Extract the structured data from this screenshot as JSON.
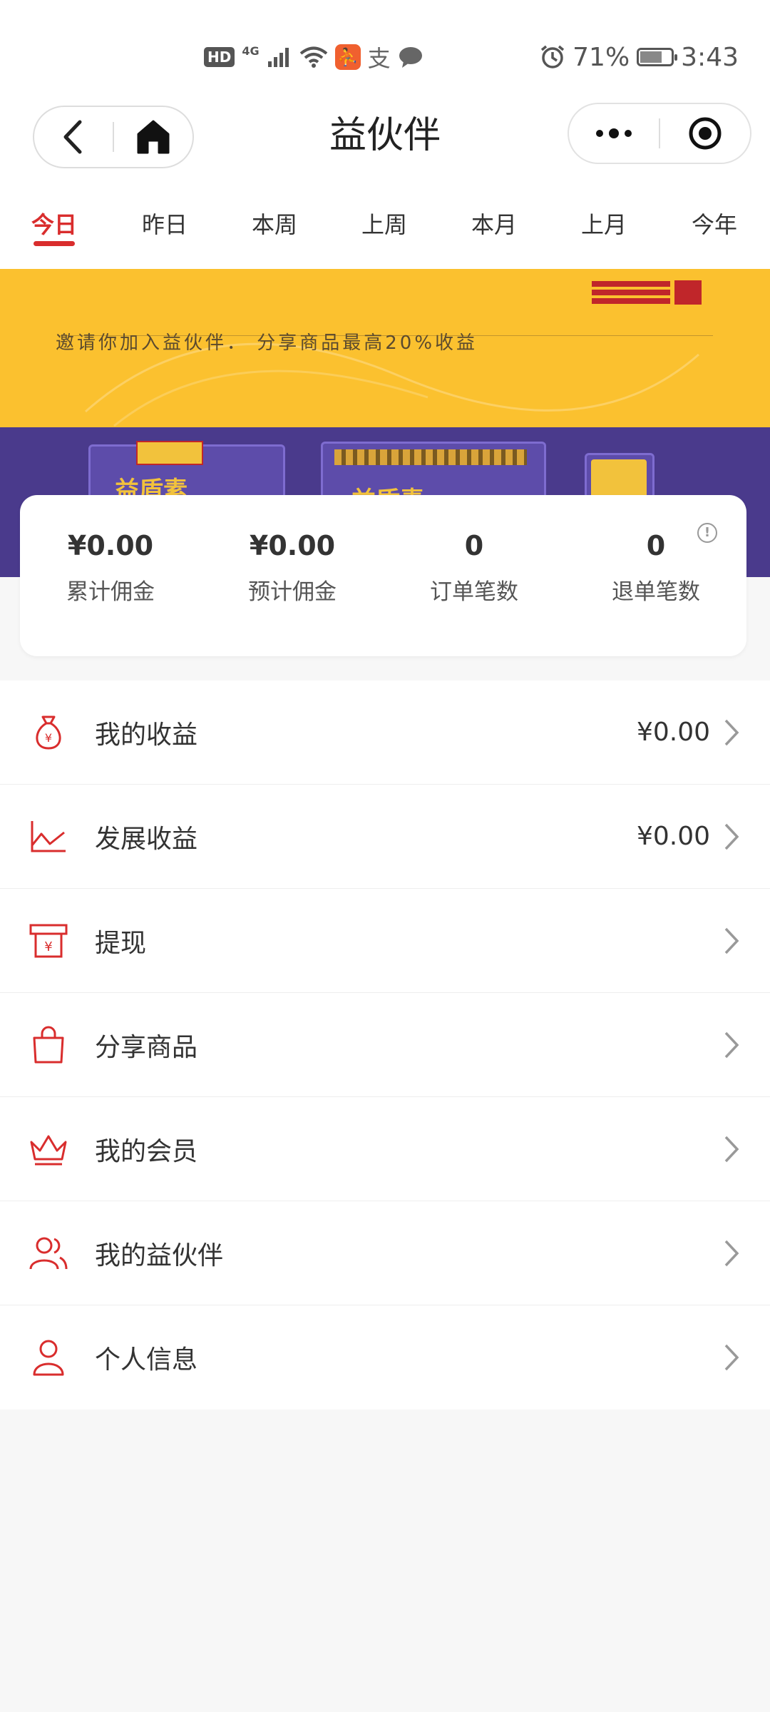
{
  "status_bar": {
    "hd": "HD",
    "network": "4G",
    "app_badge": "支",
    "battery": "71%",
    "battery_level": 0.71,
    "time": "3:43"
  },
  "header": {
    "title": "益伙伴"
  },
  "tabs": [
    {
      "label": "今日",
      "active": true
    },
    {
      "label": "昨日",
      "active": false
    },
    {
      "label": "本周",
      "active": false
    },
    {
      "label": "上周",
      "active": false
    },
    {
      "label": "本月",
      "active": false
    },
    {
      "label": "上月",
      "active": false
    },
    {
      "label": "今年",
      "active": false
    }
  ],
  "banner": {
    "slogan": "邀请你加入益伙伴． 分享商品最高20%收益",
    "product_name": "益盾素",
    "colors": {
      "top": "#fbc12f",
      "bottom": "#4a3a8c"
    }
  },
  "stats": [
    {
      "value": "¥0.00",
      "label": "累计佣金"
    },
    {
      "value": "¥0.00",
      "label": "预计佣金"
    },
    {
      "value": "0",
      "label": "订单笔数"
    },
    {
      "value": "0",
      "label": "退单笔数"
    }
  ],
  "menu": [
    {
      "label": "我的收益",
      "value": "¥0.00",
      "icon": "money-bag-icon"
    },
    {
      "label": "发展收益",
      "value": "¥0.00",
      "icon": "line-chart-icon"
    },
    {
      "label": "提现",
      "value": "",
      "icon": "withdraw-icon"
    },
    {
      "label": "分享商品",
      "value": "",
      "icon": "shopping-bag-icon"
    },
    {
      "label": "我的会员",
      "value": "",
      "icon": "crown-icon"
    },
    {
      "label": "我的益伙伴",
      "value": "",
      "icon": "users-icon"
    },
    {
      "label": "个人信息",
      "value": "",
      "icon": "user-icon"
    }
  ],
  "accent_color": "#d92d2d"
}
